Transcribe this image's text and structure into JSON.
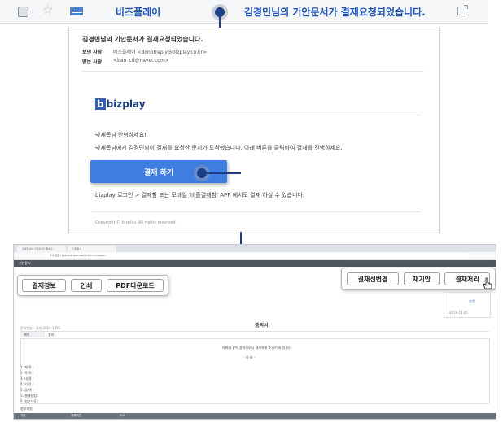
{
  "mail_row": {
    "sender": "비즈플레이",
    "subject": "김경민님의 기안문서가 결재요청되었습니다."
  },
  "email": {
    "subject": "김경민님의 기안문서가 결재요청되었습니다.",
    "from_label": "보낸 사람",
    "from_value": "비즈플레이 <donotreply@bizplay.co.kr>",
    "to_label": "받는 사람",
    "to_value": "<ban_cd@naver.com>",
    "logo_text": "bizplay",
    "greeting": "박새롬님 안녕하세요!",
    "message": "박새롬님에게 김경민님이 결재를 요청한 문서가 도착했습니다. 아래 버튼을 클릭하여 결재를 진행하세요.",
    "approve_button": "결재 하기",
    "login_note": "bizplay 로그인 > 결재함 또는 모바일 '비즐결재함' APP 에서도 결재 하실 수 있습니다.",
    "copyright": "Copyright © bizplay. All rights reserved."
  },
  "browser": {
    "tabs": [
      "김경민님의 기안문서가 결재요...",
      "기안문서"
    ],
    "url": "주의 요함 | approval.webcashcorp.com/bizapp/...",
    "app_title": "기안문서",
    "left_buttons": [
      "결재정보",
      "인쇄",
      "PDF다운로드"
    ],
    "right_buttons": [
      "결재선변경",
      "재기안",
      "결재처리"
    ],
    "doc_title": "품의서",
    "approval_cell": "승인",
    "approval_date": "2019.11.05",
    "doc_meta": "문서번호 : 결재-2019-1491",
    "field_label": "제목",
    "field_value": "품의",
    "body_text": "아래와 같이 품의하오니 재가하여 주시기 바랍니다.",
    "body_sub": "- 아 래 -",
    "list_items": [
      "1. 제  목 :",
      "2. 목  적 :",
      "3. 내  용 :",
      "4. 기  간 :",
      "5. 금  액 :",
      "6. 결제방법 :",
      "7. 첨부서류 :"
    ],
    "attach_note": "첨부파일",
    "footer": [
      "기본",
      "결재의견",
      "비고"
    ]
  }
}
